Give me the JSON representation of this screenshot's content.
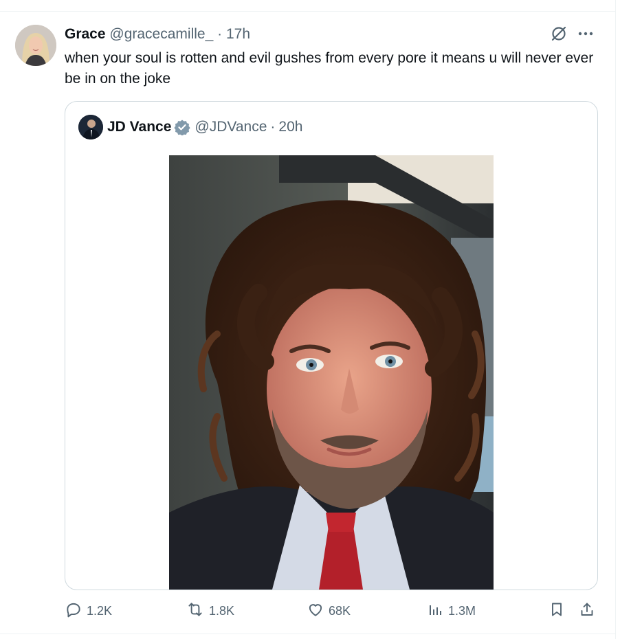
{
  "tweet": {
    "author_name": "Grace",
    "author_handle": "@gracecamille_",
    "separator": "·",
    "time": "17h",
    "text": "when your soul is rotten and evil gushes from every pore it means u will never ever be in on the joke"
  },
  "quote": {
    "author_name": "JD Vance",
    "author_handle": "@JDVance",
    "separator": "·",
    "time": "20h",
    "verified": true
  },
  "actions": {
    "replies": "1.2K",
    "reposts": "1.8K",
    "likes": "68K",
    "views": "1.3M"
  },
  "icons": {
    "top": [
      "grok-icon",
      "more-icon"
    ],
    "bar": [
      "reply-icon",
      "repost-icon",
      "like-icon",
      "views-icon",
      "bookmark-icon",
      "share-icon"
    ]
  },
  "colors": {
    "text": "#0f1419",
    "muted": "#536471",
    "border": "#cfd9de",
    "verified": "#829aab"
  }
}
